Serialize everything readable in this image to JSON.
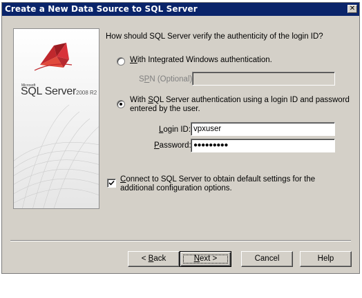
{
  "window": {
    "title": "Create a New Data Source to SQL Server",
    "close_glyph": "✕"
  },
  "banner": {
    "logo_microsoft": "Microsoft",
    "logo_product": "SQL Server",
    "logo_version": "2008 R2"
  },
  "auth": {
    "question": "How should SQL Server verify the authenticity of the login ID?",
    "integrated_label_prefix": "",
    "integrated_label_hotkey": "W",
    "integrated_label_rest": "ith Integrated Windows authentication.",
    "spn_label_prefix": "S",
    "spn_label_hotkey": "P",
    "spn_label_rest": "N (Optional):",
    "spn_value": "",
    "sql_label_line1_prefix": "With ",
    "sql_label_line1_hotkey": "S",
    "sql_label_line1_rest": "QL Server authentication using a login ID and password",
    "sql_label_line2": "entered by the user.",
    "selected": "sql"
  },
  "credentials": {
    "login_label_prefix": "",
    "login_label_hotkey": "L",
    "login_label_rest": "ogin ID:",
    "login_value": "vpxuser",
    "password_label_prefix": "",
    "password_label_hotkey": "P",
    "password_label_rest": "assword:",
    "password_value": "●●●●●●●●●"
  },
  "connect": {
    "checked": true,
    "label_line1_prefix": "",
    "label_line1_hotkey": "C",
    "label_line1_rest": "onnect to SQL Server to obtain default settings for the",
    "label_line2": "additional configuration options."
  },
  "buttons": {
    "back_prefix": "< ",
    "back_hotkey": "B",
    "back_rest": "ack",
    "next_hotkey": "N",
    "next_rest": "ext >",
    "cancel": "Cancel",
    "help": "Help"
  },
  "colors": {
    "titlebar": "#0a246a",
    "dialog_face": "#d4d0c8"
  }
}
